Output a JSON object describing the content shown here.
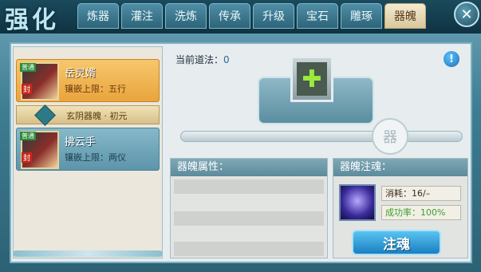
{
  "header": {
    "logo_text": "强化",
    "tabs": [
      {
        "label": "炼器"
      },
      {
        "label": "灌注"
      },
      {
        "label": "洗炼"
      },
      {
        "label": "传承"
      },
      {
        "label": "升级"
      },
      {
        "label": "宝石"
      },
      {
        "label": "雕琢"
      },
      {
        "label": "器魄",
        "active": true
      }
    ],
    "close_icon": "close-icon"
  },
  "left_list": {
    "items": [
      {
        "name": "岳灵婿",
        "tag": "普通",
        "badge": "封",
        "limit": "镶嵌上限：五行",
        "selected": true
      },
      {
        "name": "拂云手",
        "tag": "普通",
        "badge": "封",
        "limit": "镶嵌上限：两仪",
        "selected": false
      }
    ],
    "section_label": "玄阴器魄 · 初元"
  },
  "main": {
    "current_dao_label": "当前道法：",
    "current_dao_value": "0",
    "slot_symbol": "✚",
    "seal_char": "器"
  },
  "properties": {
    "title": "器魄属性："
  },
  "inject": {
    "title": "器魄注魂：",
    "cost": "消耗：16/–",
    "success_rate": "成功率：100%",
    "button_label": "注魂"
  },
  "colors": {
    "accent": "#1a7fc1",
    "active_tab": "#d9c79e",
    "selected_item": "#e9a43d",
    "success_green": "#3e9e2c"
  }
}
